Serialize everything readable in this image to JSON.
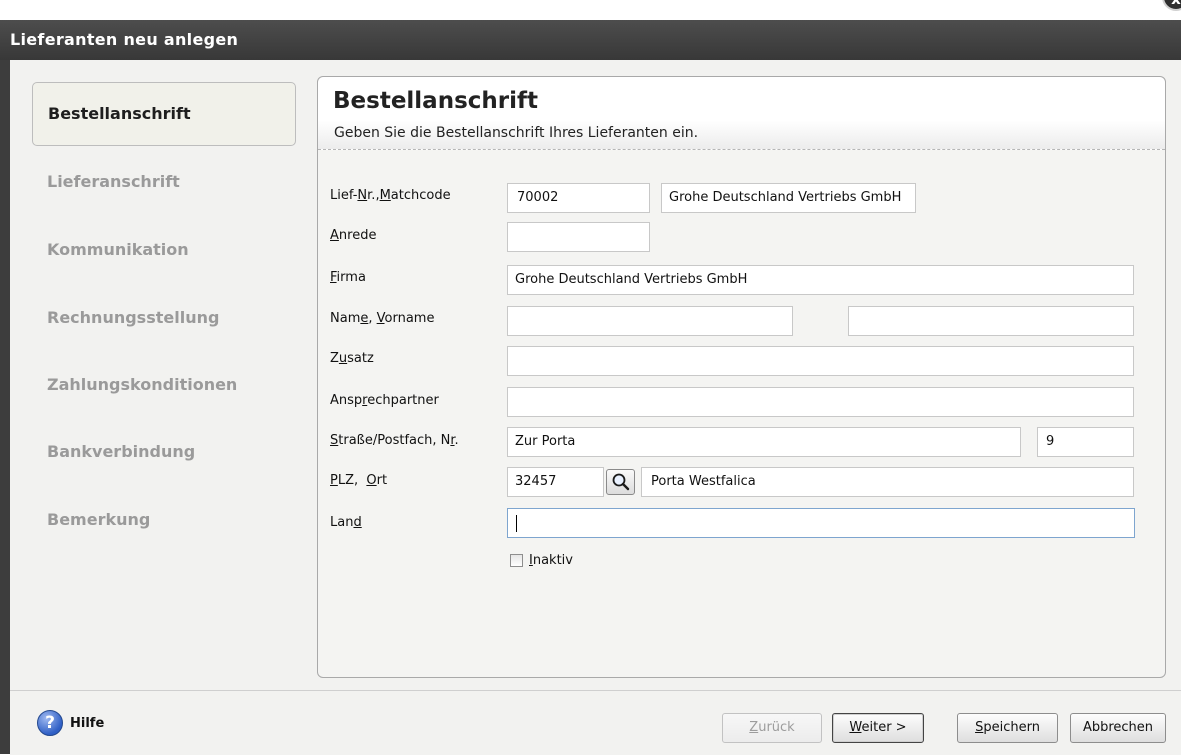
{
  "window": {
    "title": "Lieferanten neu anlegen",
    "close_label": "x"
  },
  "sidebar": {
    "items": [
      {
        "label": "Bestellanschrift",
        "active": true
      },
      {
        "label": "Lieferanschrift",
        "active": false
      },
      {
        "label": "Kommunikation",
        "active": false
      },
      {
        "label": "Rechnungsstellung",
        "active": false
      },
      {
        "label": "Zahlungskonditionen",
        "active": false
      },
      {
        "label": "Bankverbindung",
        "active": false
      },
      {
        "label": "Bemerkung",
        "active": false
      }
    ]
  },
  "header": {
    "title": "Bestellanschrift",
    "subtitle": "Geben Sie die Bestellanschrift Ihres Lieferanten ein."
  },
  "form": {
    "labels": {
      "lief_nr": {
        "pre": "Lief-",
        "key": "N",
        "post": "r.,",
        "key2": "M",
        "post2": "atchcode"
      },
      "anrede": {
        "pre": "",
        "key": "A",
        "post": "nrede"
      },
      "firma": {
        "pre": "",
        "key": "F",
        "post": "irma"
      },
      "name": {
        "pre": "Nam",
        "key": "e",
        "post": ", ",
        "key2": "V",
        "post2": "orname"
      },
      "zusatz": {
        "pre": "Z",
        "key": "u",
        "post": "satz"
      },
      "ansprechpartner": {
        "pre": "Ansp",
        "key": "r",
        "post": "echpartner"
      },
      "strasse": {
        "pre": "",
        "key": "S",
        "post": "traße/Postfach, N",
        "key2": "r",
        "post2": "."
      },
      "plz": {
        "pre": "",
        "key": "P",
        "post": "LZ,  ",
        "key2": "O",
        "post2": "rt"
      },
      "land": {
        "pre": "Lan",
        "key": "d",
        "post": ""
      }
    },
    "values": {
      "lief_nr": "70002",
      "matchcode": "Grohe Deutschland Vertriebs GmbH",
      "anrede": "",
      "firma": "Grohe Deutschland Vertriebs GmbH",
      "name": "",
      "vorname": "",
      "zusatz": "",
      "ansprechpartner": "",
      "strasse": "Zur Porta",
      "hausnr": "9",
      "plz": "32457",
      "ort": "Porta Westfalica",
      "land": ""
    },
    "inaktiv": {
      "pre": "",
      "key": "I",
      "post": "naktiv",
      "checked": false
    }
  },
  "footer": {
    "help": "Hilfe",
    "help_icon": "?",
    "buttons": {
      "back": {
        "key": "Z",
        "post": "urück",
        "disabled": true
      },
      "next": {
        "key": "W",
        "post": "eiter >",
        "disabled": false
      },
      "save": {
        "key": "S",
        "post": "peichern",
        "disabled": false
      },
      "cancel": {
        "key": "",
        "post": "Abbrechen",
        "disabled": false
      }
    }
  },
  "colors": {
    "titlebar": "#3d3d3d",
    "background": "#f2f2f0",
    "nav_inactive": "#9a9a9a",
    "focus_border": "#7ea5cf"
  }
}
